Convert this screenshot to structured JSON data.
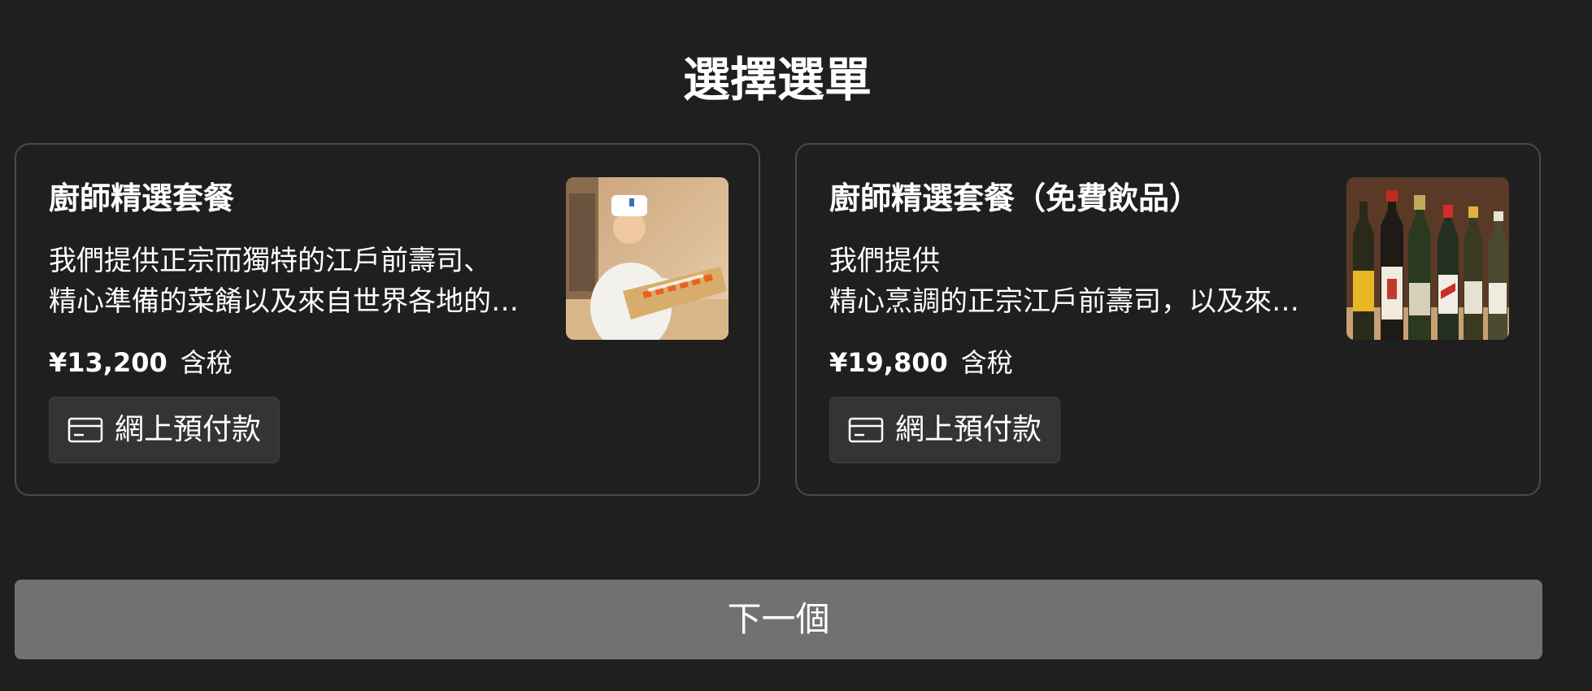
{
  "page": {
    "title": "選擇選單"
  },
  "menus": [
    {
      "title": "廚師精選套餐",
      "description": [
        "我們提供正宗而獨特的江戶前壽司、",
        "精心準備的菜餚以及來自世界各地的…"
      ],
      "price": "¥13,200",
      "tax": "含稅",
      "prepay_label": "網上預付款",
      "prepay_icon": "credit-card-icon",
      "image": "chef-with-sushi-photo"
    },
    {
      "title": "廚師精選套餐（免費飲品）",
      "description": [
        "我們提供",
        "精心烹調的正宗江戶前壽司，以及來…"
      ],
      "price": "¥19,800",
      "tax": "含稅",
      "prepay_label": "網上預付款",
      "prepay_icon": "credit-card-icon",
      "image": "wine-and-sake-bottles-photo"
    }
  ],
  "next_button": {
    "label": "下一個"
  },
  "colors": {
    "background": "#1f1f1f",
    "card_border": "#4a4a4a",
    "prepay_button_bg": "#343434",
    "next_button_bg": "#727171",
    "text": "#ffffff"
  }
}
